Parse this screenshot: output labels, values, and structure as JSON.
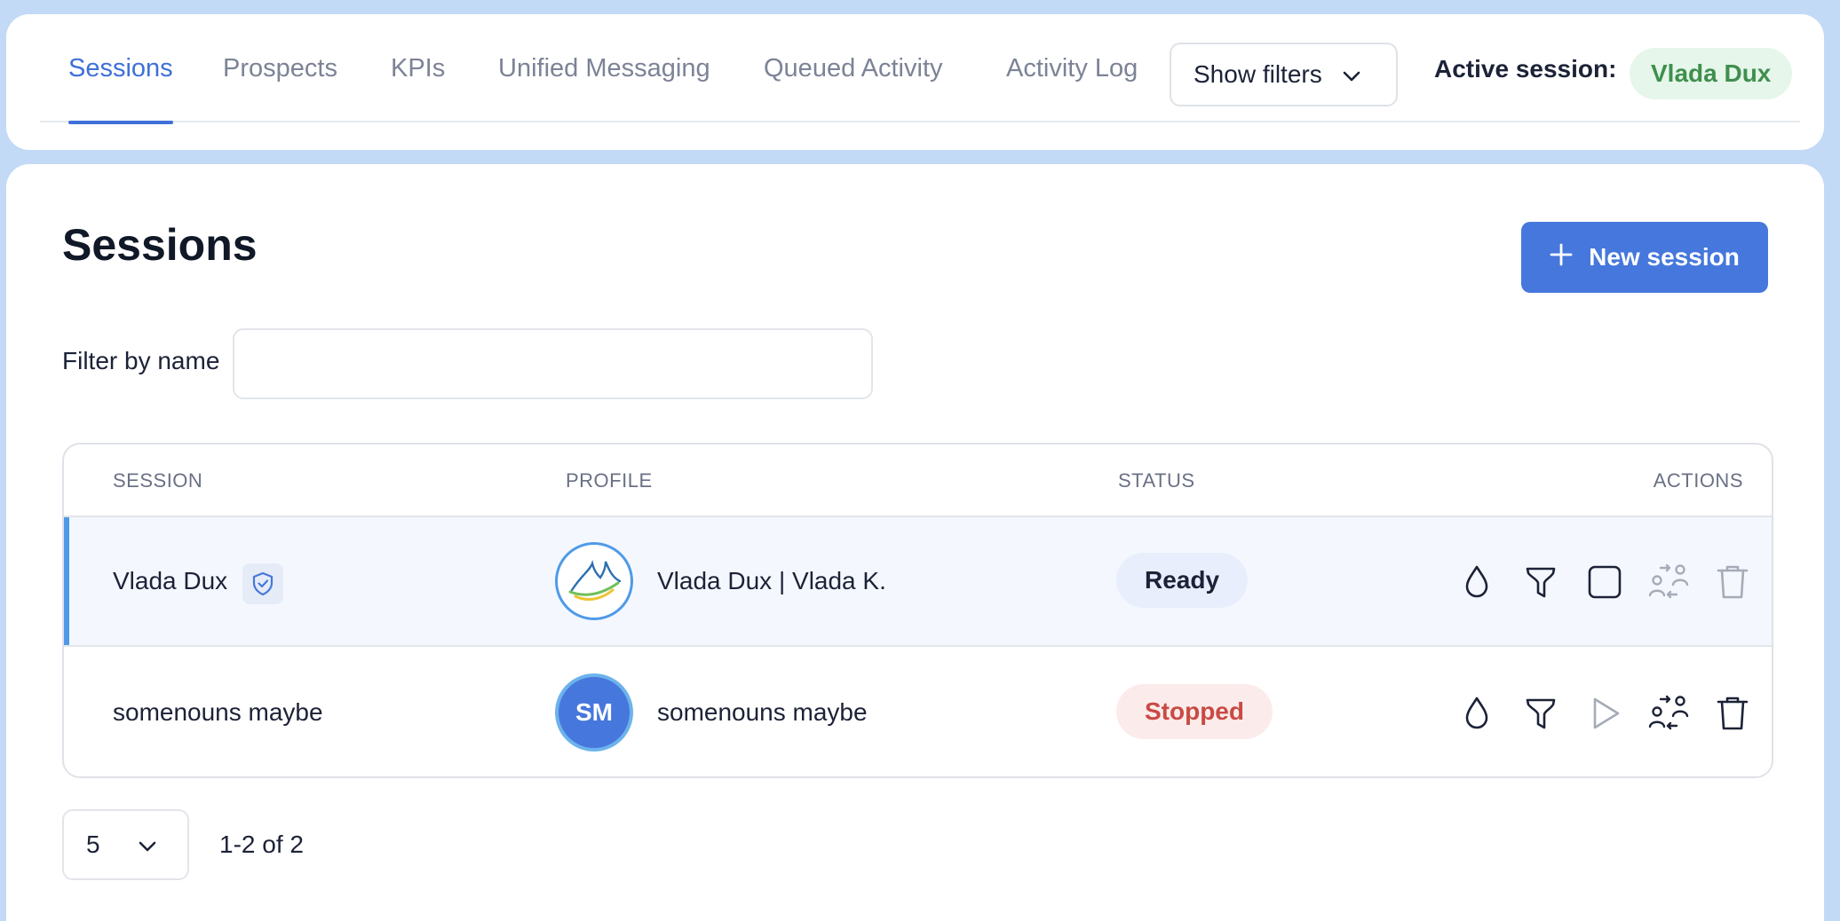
{
  "tabs": [
    {
      "label": "Sessions",
      "active": true
    },
    {
      "label": "Prospects",
      "active": false
    },
    {
      "label": "KPIs",
      "active": false
    },
    {
      "label": "Unified Messaging",
      "active": false
    },
    {
      "label": "Queued Activity",
      "active": false
    },
    {
      "label": "Activity Log",
      "active": false
    }
  ],
  "filters": {
    "label": "Show filters",
    "icon": "chevron-down-icon"
  },
  "active_session": {
    "label": "Active session:",
    "name": "Vlada Dux"
  },
  "page": {
    "title": "Sessions",
    "new_button": "New session"
  },
  "filter": {
    "label": "Filter by name",
    "value": "",
    "placeholder": ""
  },
  "table": {
    "headers": {
      "session": "SESSION",
      "profile": "PROFILE",
      "status": "STATUS",
      "actions": "ACTIONS"
    },
    "rows": [
      {
        "session": "Vlada Dux",
        "verified": true,
        "profile": "Vlada Dux | Vlada K.",
        "avatar": "logo",
        "status": "Ready",
        "selected": true
      },
      {
        "session": "somenouns maybe",
        "verified": false,
        "profile": "somenouns maybe",
        "avatar": "SM",
        "status": "Stopped",
        "selected": false
      }
    ],
    "action_icons": [
      "drop-icon",
      "filter-icon",
      "stop-icon",
      "play-icon",
      "swap-users-icon",
      "trash-icon"
    ]
  },
  "pagination": {
    "per_page": "5",
    "range": "1-2 of 2"
  },
  "colors": {
    "accent": "#4677dc",
    "ready_bg": "#e8eefb",
    "stopped": "#c94a44",
    "active_badge": "#3f8f4e"
  }
}
